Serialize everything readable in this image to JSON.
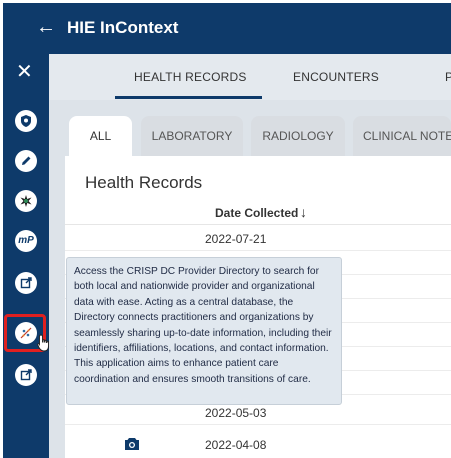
{
  "header": {
    "back_icon": "arrow-left-icon",
    "title": "HIE InContext"
  },
  "rail": {
    "close_icon": "close-icon",
    "items": [
      {
        "icon": "shield-icon",
        "glyph": "◆"
      },
      {
        "icon": "pencil-icon",
        "glyph": "✎"
      },
      {
        "icon": "star-burst-icon",
        "glyph": "✹"
      },
      {
        "icon": "myp-logo-icon",
        "glyph": "mP"
      },
      {
        "icon": "external-link-icon",
        "glyph": "↗"
      },
      {
        "icon": "provider-directory-icon",
        "glyph": "✶"
      },
      {
        "icon": "external-link-icon",
        "glyph": "↗"
      }
    ],
    "highlight_color": "#e02020"
  },
  "main_tabs": [
    "HEALTH RECORDS",
    "ENCOUNTERS",
    "P"
  ],
  "sub_tabs": [
    "ALL",
    "LABORATORY",
    "RADIOLOGY",
    "CLINICAL NOTES"
  ],
  "records": {
    "title": "Health Records",
    "column_header": "Date Collected",
    "sort_icon": "arrow-down-icon",
    "rows": [
      {
        "date": "2022-07-21"
      },
      {
        "date": "2022-05-03"
      },
      {
        "date": "2022-04-08",
        "icon": "camera-icon"
      }
    ]
  },
  "tooltip": {
    "text": "Access the CRISP DC Provider Directory to search for both local and nationwide provider and organizational data with ease. Acting as a central database, the Directory connects practitioners and organizations by seamlessly sharing up-to-date information, including their identifiers, affiliations, locations, and contact information. This application aims to enhance patient care coordination and ensures smooth transitions of care."
  },
  "colors": {
    "navy": "#0e3a6a",
    "content_bg": "#dde3e9",
    "tooltip_bg": "#e1e8ef"
  }
}
